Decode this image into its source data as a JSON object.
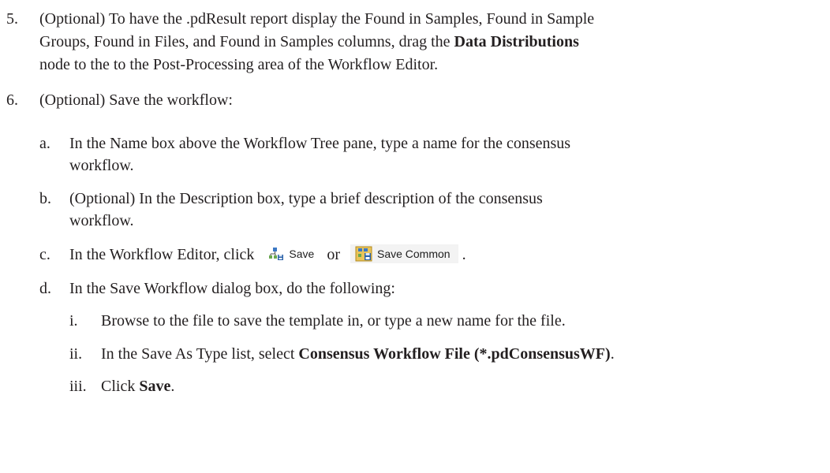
{
  "step5": {
    "number": "5.",
    "line1": "(Optional) To have the .pdResult report display the Found in Samples, Found in Sample",
    "line2_pre": "Groups, Found in Files, and Found in Samples columns, drag the ",
    "line2_bold": "Data Distributions",
    "line3": "node to the to the Post-Processing area of the Workflow Editor."
  },
  "step6": {
    "number": "6.",
    "text": "(Optional) Save the workflow:"
  },
  "sub_a": {
    "label": "a.",
    "line1": "In the Name box above the Workflow Tree pane, type a name for the consensus",
    "line2": "workflow."
  },
  "sub_b": {
    "label": "b.",
    "line1": "(Optional) In the Description box, type a brief description of the consensus",
    "line2": "workflow."
  },
  "sub_c": {
    "label": "c.",
    "pre": "In the Workflow Editor, click",
    "save_label": "Save",
    "or": "or",
    "save_common_label": "Save Common",
    "post": "."
  },
  "sub_d": {
    "label": "d.",
    "text": "In the Save Workflow dialog box, do the following:"
  },
  "sub_i": {
    "label": "i.",
    "text": "Browse to the file to save the template in, or type a new name for the file."
  },
  "sub_ii": {
    "label": "ii.",
    "pre": "In the Save As Type list, select ",
    "bold": "Consensus Workflow File (*.pdConsensusWF)",
    "post": "."
  },
  "sub_iii": {
    "label": "iii.",
    "pre": "Click ",
    "bold": "Save",
    "post": "."
  },
  "icons": {
    "save": "workflow-save-icon",
    "save_common": "workflow-save-common-icon"
  }
}
